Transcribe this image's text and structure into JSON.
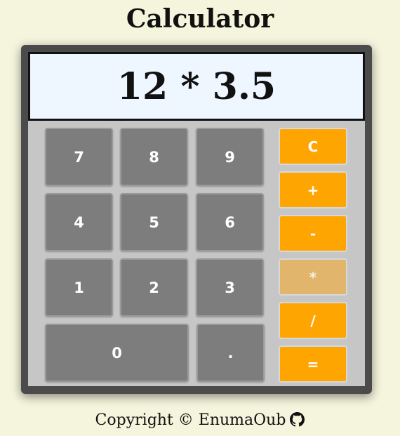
{
  "title": "Calculator",
  "display": "12 * 3.5",
  "keys": {
    "seven": "7",
    "eight": "8",
    "nine": "9",
    "four": "4",
    "five": "5",
    "six": "6",
    "one": "1",
    "two": "2",
    "three": "3",
    "zero": "0",
    "dot": "."
  },
  "operators": {
    "clear": "C",
    "plus": "+",
    "minus": "-",
    "multiply": "*",
    "divide": "/",
    "equals": "="
  },
  "active_operator": "multiply",
  "footer": {
    "text": "Copyright © EnumaOub"
  },
  "icons": {
    "footer_icon": "github-icon"
  },
  "colors": {
    "background": "#f5f4dc",
    "number_key": "#7d7d7d",
    "operator_key": "#ffa502",
    "operator_key_active": "#e1b56b",
    "display_bg": "#eef6ff"
  }
}
